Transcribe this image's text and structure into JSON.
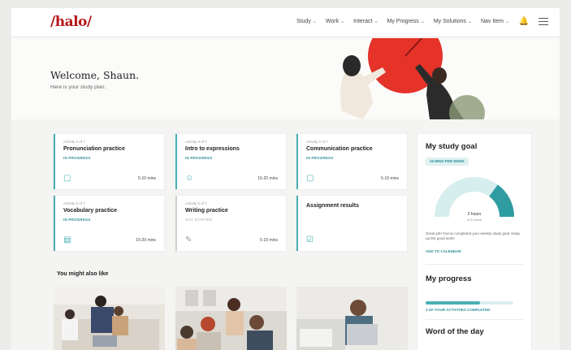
{
  "app": {
    "logo": "/halo/"
  },
  "nav": {
    "items": [
      "Study",
      "Work",
      "Interact",
      "My Progress",
      "My Solutions",
      "Nav Item"
    ]
  },
  "hero": {
    "title": "Welcome, Shaun.",
    "subtitle": "Here is your study plan."
  },
  "cards": [
    {
      "meta": "Activity 4 of 7",
      "title": "Pronunciation practice",
      "status": "IN PROGRESS",
      "mins": "5-10 mins",
      "icon": "chat-icon"
    },
    {
      "meta": "Activity 3 of 7",
      "title": "Intro to expressions",
      "status": "IN PROGRESS",
      "mins": "15-20 mins",
      "icon": "smile-icon"
    },
    {
      "meta": "Activity 2 of 7",
      "title": "Communication practice",
      "status": "IN PROGRESS",
      "mins": "5-10 mins",
      "icon": "chat-icon"
    },
    {
      "meta": "Activity 6 of 7",
      "title": "Vocabulary practice",
      "status": "IN PROGRESS",
      "mins": "15-20 mins",
      "icon": "book-icon"
    },
    {
      "meta": "Activity 5 of 7",
      "title": "Writing practice",
      "status": "NOT STARTED",
      "mins": "5-10 mins",
      "icon": "pencil-icon"
    },
    {
      "meta": "",
      "title": "Assignment results",
      "status": "",
      "mins": "",
      "icon": "checkbox-icon"
    }
  ],
  "section": {
    "recommend_title": "You might also like"
  },
  "goal": {
    "title": "My study goal",
    "pill": "16 MINS PER WEEK",
    "progress_fraction": 0.3,
    "center_value": "2 hours",
    "center_sub": "of 5 hours",
    "text": "Great job! You've completed your weekly study goal. Keep up the good work!",
    "link": "ADD TO CALENDAR"
  },
  "progress": {
    "title": "My progress",
    "fraction": 0.62,
    "caption": "3 OF FOUR ACTIVITIES COMPLETED"
  },
  "word": {
    "title": "Word of the day"
  },
  "colors": {
    "accent": "#49b0b3",
    "brand": "#b5161b"
  }
}
